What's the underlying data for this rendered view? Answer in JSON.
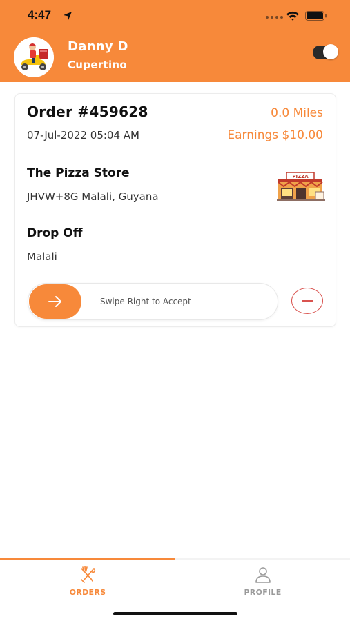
{
  "status_bar": {
    "time": "4:47"
  },
  "header": {
    "user_name": "Danny D",
    "user_city": "Cupertino",
    "online_toggle": true
  },
  "order": {
    "number": "Order #459628",
    "date": "07-Jul-2022 05:04 AM",
    "distance": "0.0 Miles",
    "earnings": "Earnings $10.00",
    "store_name": "The Pizza Store",
    "store_address": "JHVW+8G Malali, Guyana",
    "dropoff_label": "Drop Off",
    "dropoff_address": "Malali",
    "swipe_text": "Swipe Right to Accept",
    "store_sign": "PIZZA"
  },
  "tabbar": {
    "orders_label": "ORDERS",
    "profile_label": "PROFILE",
    "active_tab": "orders"
  },
  "colors": {
    "accent": "#F7893A",
    "reject": "#d9534f",
    "inactive_tab": "#9a9a9a"
  }
}
